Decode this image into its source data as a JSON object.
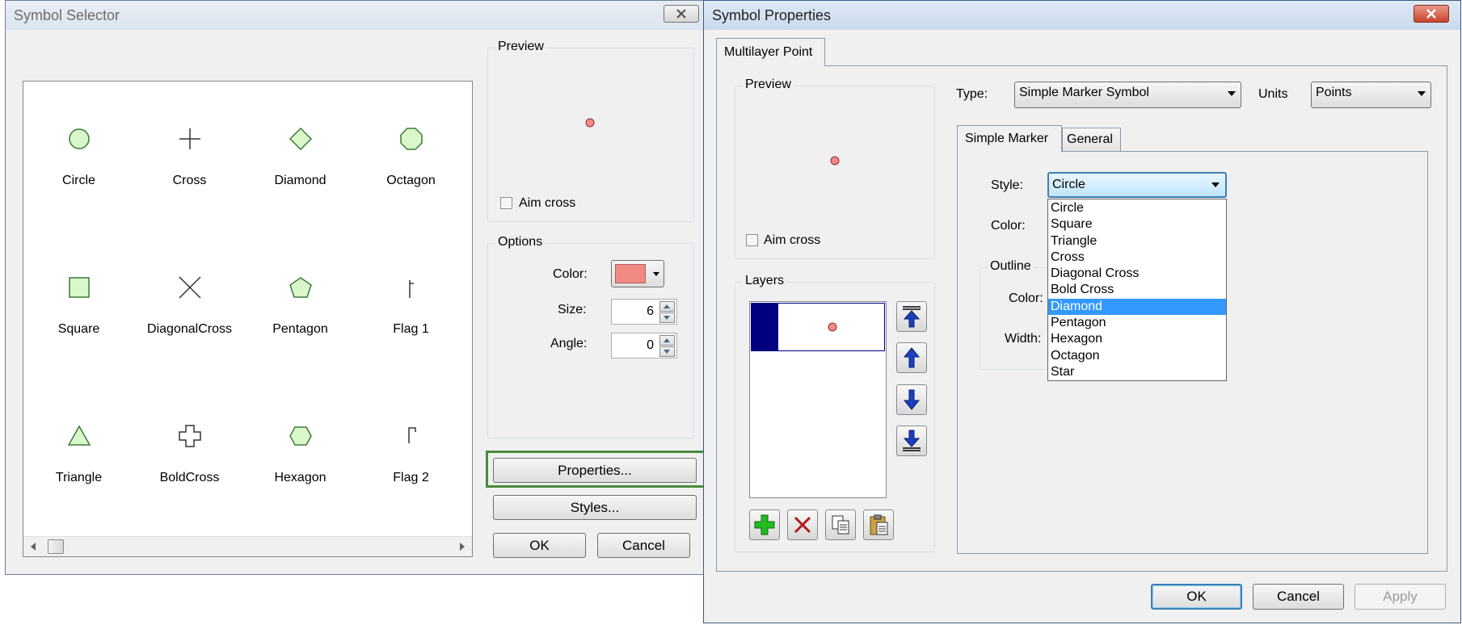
{
  "selector": {
    "title": "Symbol Selector",
    "symbols": [
      {
        "name": "Circle"
      },
      {
        "name": "Cross"
      },
      {
        "name": "Diamond"
      },
      {
        "name": "Octagon"
      },
      {
        "name": "Square"
      },
      {
        "name": "DiagonalCross"
      },
      {
        "name": "Pentagon"
      },
      {
        "name": "Flag 1"
      },
      {
        "name": "Triangle"
      },
      {
        "name": "BoldCross"
      },
      {
        "name": "Hexagon"
      },
      {
        "name": "Flag 2"
      }
    ],
    "preview_label": "Preview",
    "aim_cross_label": "Aim cross",
    "options_label": "Options",
    "color_label": "Color:",
    "color_value": "#f28a84",
    "size_label": "Size:",
    "size_value": "6",
    "angle_label": "Angle:",
    "angle_value": "0",
    "properties_button": "Properties...",
    "styles_button": "Styles...",
    "ok_button": "OK",
    "cancel_button": "Cancel"
  },
  "properties": {
    "title": "Symbol Properties",
    "tab_label": "Multilayer Point",
    "preview_label": "Preview",
    "aim_cross_label": "Aim cross",
    "layers_label": "Layers",
    "type_label": "Type:",
    "type_value": "Simple Marker Symbol",
    "units_label": "Units",
    "units_value": "Points",
    "subtabs": [
      "Simple Marker",
      "General"
    ],
    "style_label": "Style:",
    "style_value": "Circle",
    "color_label": "Color:",
    "outline_label": "Outline",
    "outline_color_label": "Color:",
    "width_label": "Width:",
    "style_options": [
      "Circle",
      "Square",
      "Triangle",
      "Cross",
      "Diagonal Cross",
      "Bold Cross",
      "Diamond",
      "Pentagon",
      "Hexagon",
      "Octagon",
      "Star"
    ],
    "highlighted_option": "Diamond",
    "ok_button": "OK",
    "cancel_button": "Cancel",
    "apply_button": "Apply"
  },
  "colors": {
    "marker_fill": "#d9f7c9",
    "marker_stroke": "#3a7a3a",
    "preview_dot": "#f28a84",
    "layer_swatch": "#000080",
    "highlight": "#3399ff",
    "focus_box": "#4a8a3a"
  },
  "icons": {
    "move_top": "move-to-top-icon",
    "move_up": "move-up-icon",
    "move_down": "move-down-icon",
    "move_bottom": "move-to-bottom-icon",
    "add": "add-layer-icon",
    "remove": "remove-layer-icon",
    "copy": "copy-icon",
    "paste": "paste-icon"
  }
}
